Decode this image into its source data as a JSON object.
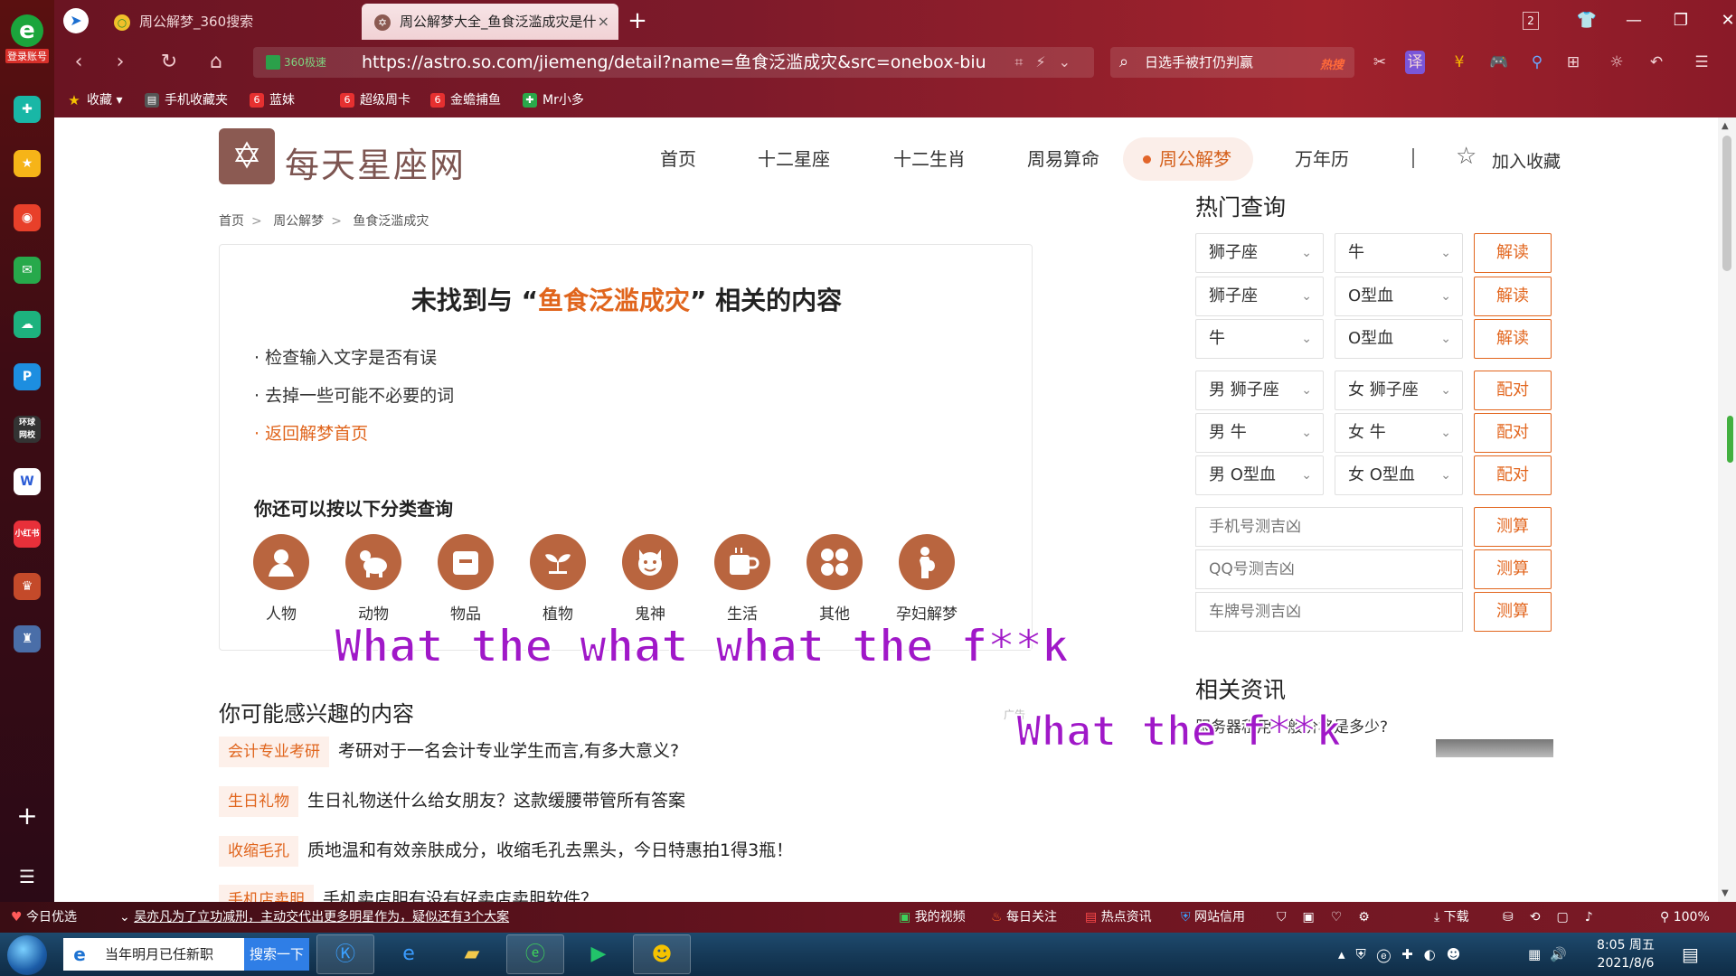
{
  "browser": {
    "left_sidebar": {
      "logo_label": "登录账号",
      "apps": [
        "应用",
        "收藏",
        "微博",
        "邮箱",
        "云盘",
        "P",
        "环球网校",
        "W",
        "小红书",
        "游戏",
        "游戏2"
      ]
    },
    "tabs": [
      {
        "label": "周公解梦_360搜索",
        "active": false
      },
      {
        "label": "周公解梦大全_鱼食泛滥成灾是什",
        "active": true
      }
    ],
    "tab_count_badge": "2",
    "address": {
      "safe_label": "360极速",
      "url": "https://astro.so.com/jiemeng/detail?name=鱼食泛滥成灾&src=onebox-biu_"
    },
    "search": {
      "text": "日选手被打仍判赢",
      "hot_label": "热搜"
    },
    "bookmarks": [
      "收藏",
      "手机收藏夹",
      "蓝妹",
      "超级周卡",
      "金蟾捕鱼",
      "Mr小多"
    ]
  },
  "site": {
    "logo_text": "每天星座网",
    "nav": [
      "首页",
      "十二星座",
      "十二生肖",
      "周易算命",
      "周公解梦",
      "万年历"
    ],
    "nav_active_index": 4,
    "add_favorite": "加入收藏",
    "breadcrumb": [
      "首页",
      "周公解梦",
      "鱼食泛滥成灾"
    ]
  },
  "notfound": {
    "title_prefix": "未找到与 “",
    "keyword": "鱼食泛滥成灾",
    "title_suffix": "” 相关的内容",
    "tips": [
      "· 检查输入文字是否有误",
      "· 去掉一些可能不必要的词"
    ],
    "back_link": "· 返回解梦首页",
    "category_title": "你还可以按以下分类查询",
    "categories": [
      "人物",
      "动物",
      "物品",
      "植物",
      "鬼神",
      "生活",
      "其他",
      "孕妇解梦"
    ]
  },
  "interest": {
    "title": "你可能感兴趣的内容",
    "ad_label": "广告",
    "items": [
      {
        "tag": "会计专业考研",
        "text": "考研对于一名会计专业学生而言,有多大意义?"
      },
      {
        "tag": "生日礼物",
        "text": "生日礼物送什么给女朋友？这款缓腰带管所有答案"
      },
      {
        "tag": "收缩毛孔",
        "text": "质地温和有效亲肤成分，收缩毛孔去黑头，今日特惠拍1得3瓶！"
      },
      {
        "tag": "手机店卖胆",
        "text": "手机卖店胆有没有好卖店卖胆软件？"
      }
    ]
  },
  "sidebar": {
    "hot_title": "热门查询",
    "rows": [
      {
        "a": "狮子座",
        "b": "牛",
        "action": "解读"
      },
      {
        "a": "狮子座",
        "b": "O型血",
        "action": "解读"
      },
      {
        "a": "牛",
        "b": "O型血",
        "action": "解读"
      },
      {
        "a": "男 狮子座",
        "b": "女 狮子座",
        "action": "配对"
      },
      {
        "a": "男 牛",
        "b": "女 牛",
        "action": "配对"
      },
      {
        "a": "男 O型血",
        "b": "女 O型血",
        "action": "配对"
      }
    ],
    "inputs": [
      {
        "placeholder": "手机号测吉凶",
        "action": "测算"
      },
      {
        "placeholder": "QQ号测吉凶",
        "action": "测算"
      },
      {
        "placeholder": "车牌号测吉凶",
        "action": "测算"
      }
    ],
    "news_title": "相关资讯",
    "news_item": "服务器租用一般价格是多少?"
  },
  "overlays": {
    "line1": "What the what what the f**k",
    "line2": "What the f**k"
  },
  "statusbar": {
    "left_label": "今日优选",
    "ticker": "吴亦凡为了立功减刑，主动交代出更多明星作为，疑似还有3个大案",
    "items": [
      "我的视频",
      "每日关注",
      "热点资讯",
      "网站信用",
      "下载"
    ],
    "zoom": "100%"
  },
  "taskbar": {
    "search_query": "当年明月已任新职",
    "search_button": "搜索一下",
    "time": "8:05 周五",
    "date": "2021/8/6"
  }
}
